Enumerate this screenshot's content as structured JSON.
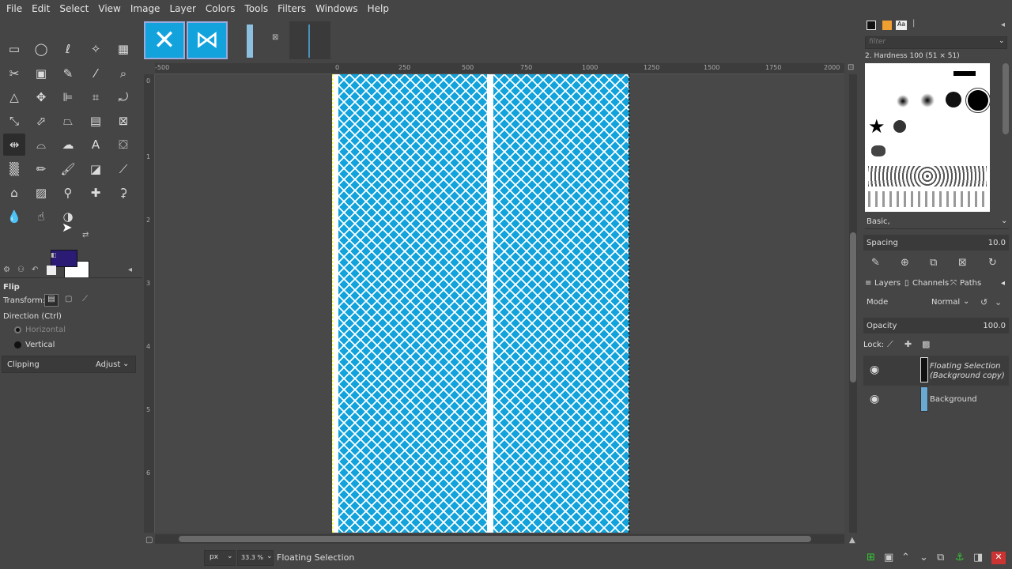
{
  "menu": [
    "File",
    "Edit",
    "Select",
    "View",
    "Image",
    "Layer",
    "Colors",
    "Tools",
    "Filters",
    "Windows",
    "Help"
  ],
  "colors": {
    "foreground": "#2b1b74",
    "background": "#ffffff",
    "pattern_blue": "#12a3dd",
    "canvas_bg": "#484848"
  },
  "tool_options": {
    "title": "Flip",
    "transform_label": "Transform:",
    "direction_label": "Direction  (Ctrl)",
    "horizontal": "Horizontal",
    "vertical": "Vertical",
    "clipping_label": "Clipping",
    "clipping_value": "Adjust"
  },
  "rulers": {
    "top": [
      "-500",
      "0",
      "250",
      "500",
      "750",
      "1000",
      "1250",
      "1500",
      "1750",
      "2000"
    ],
    "left": [
      "0",
      "1",
      "2",
      "3",
      "4",
      "5",
      "6"
    ]
  },
  "status": {
    "unit": "px",
    "zoom": "33.3 %",
    "message": "Floating Selection"
  },
  "brushes": {
    "filter_placeholder": "filter",
    "current": "2. Hardness 100 (51 × 51)",
    "category": "Basic,",
    "spacing_label": "Spacing",
    "spacing_value": "10.0"
  },
  "layers": {
    "tabs": [
      "Layers",
      "Channels",
      "Paths"
    ],
    "mode_label": "Mode",
    "mode_value": "Normal",
    "opacity_label": "Opacity",
    "opacity_value": "100.0",
    "lock_label": "Lock:",
    "items": [
      {
        "name": "Floating Selection (Background copy)"
      },
      {
        "name": "Background"
      }
    ]
  }
}
